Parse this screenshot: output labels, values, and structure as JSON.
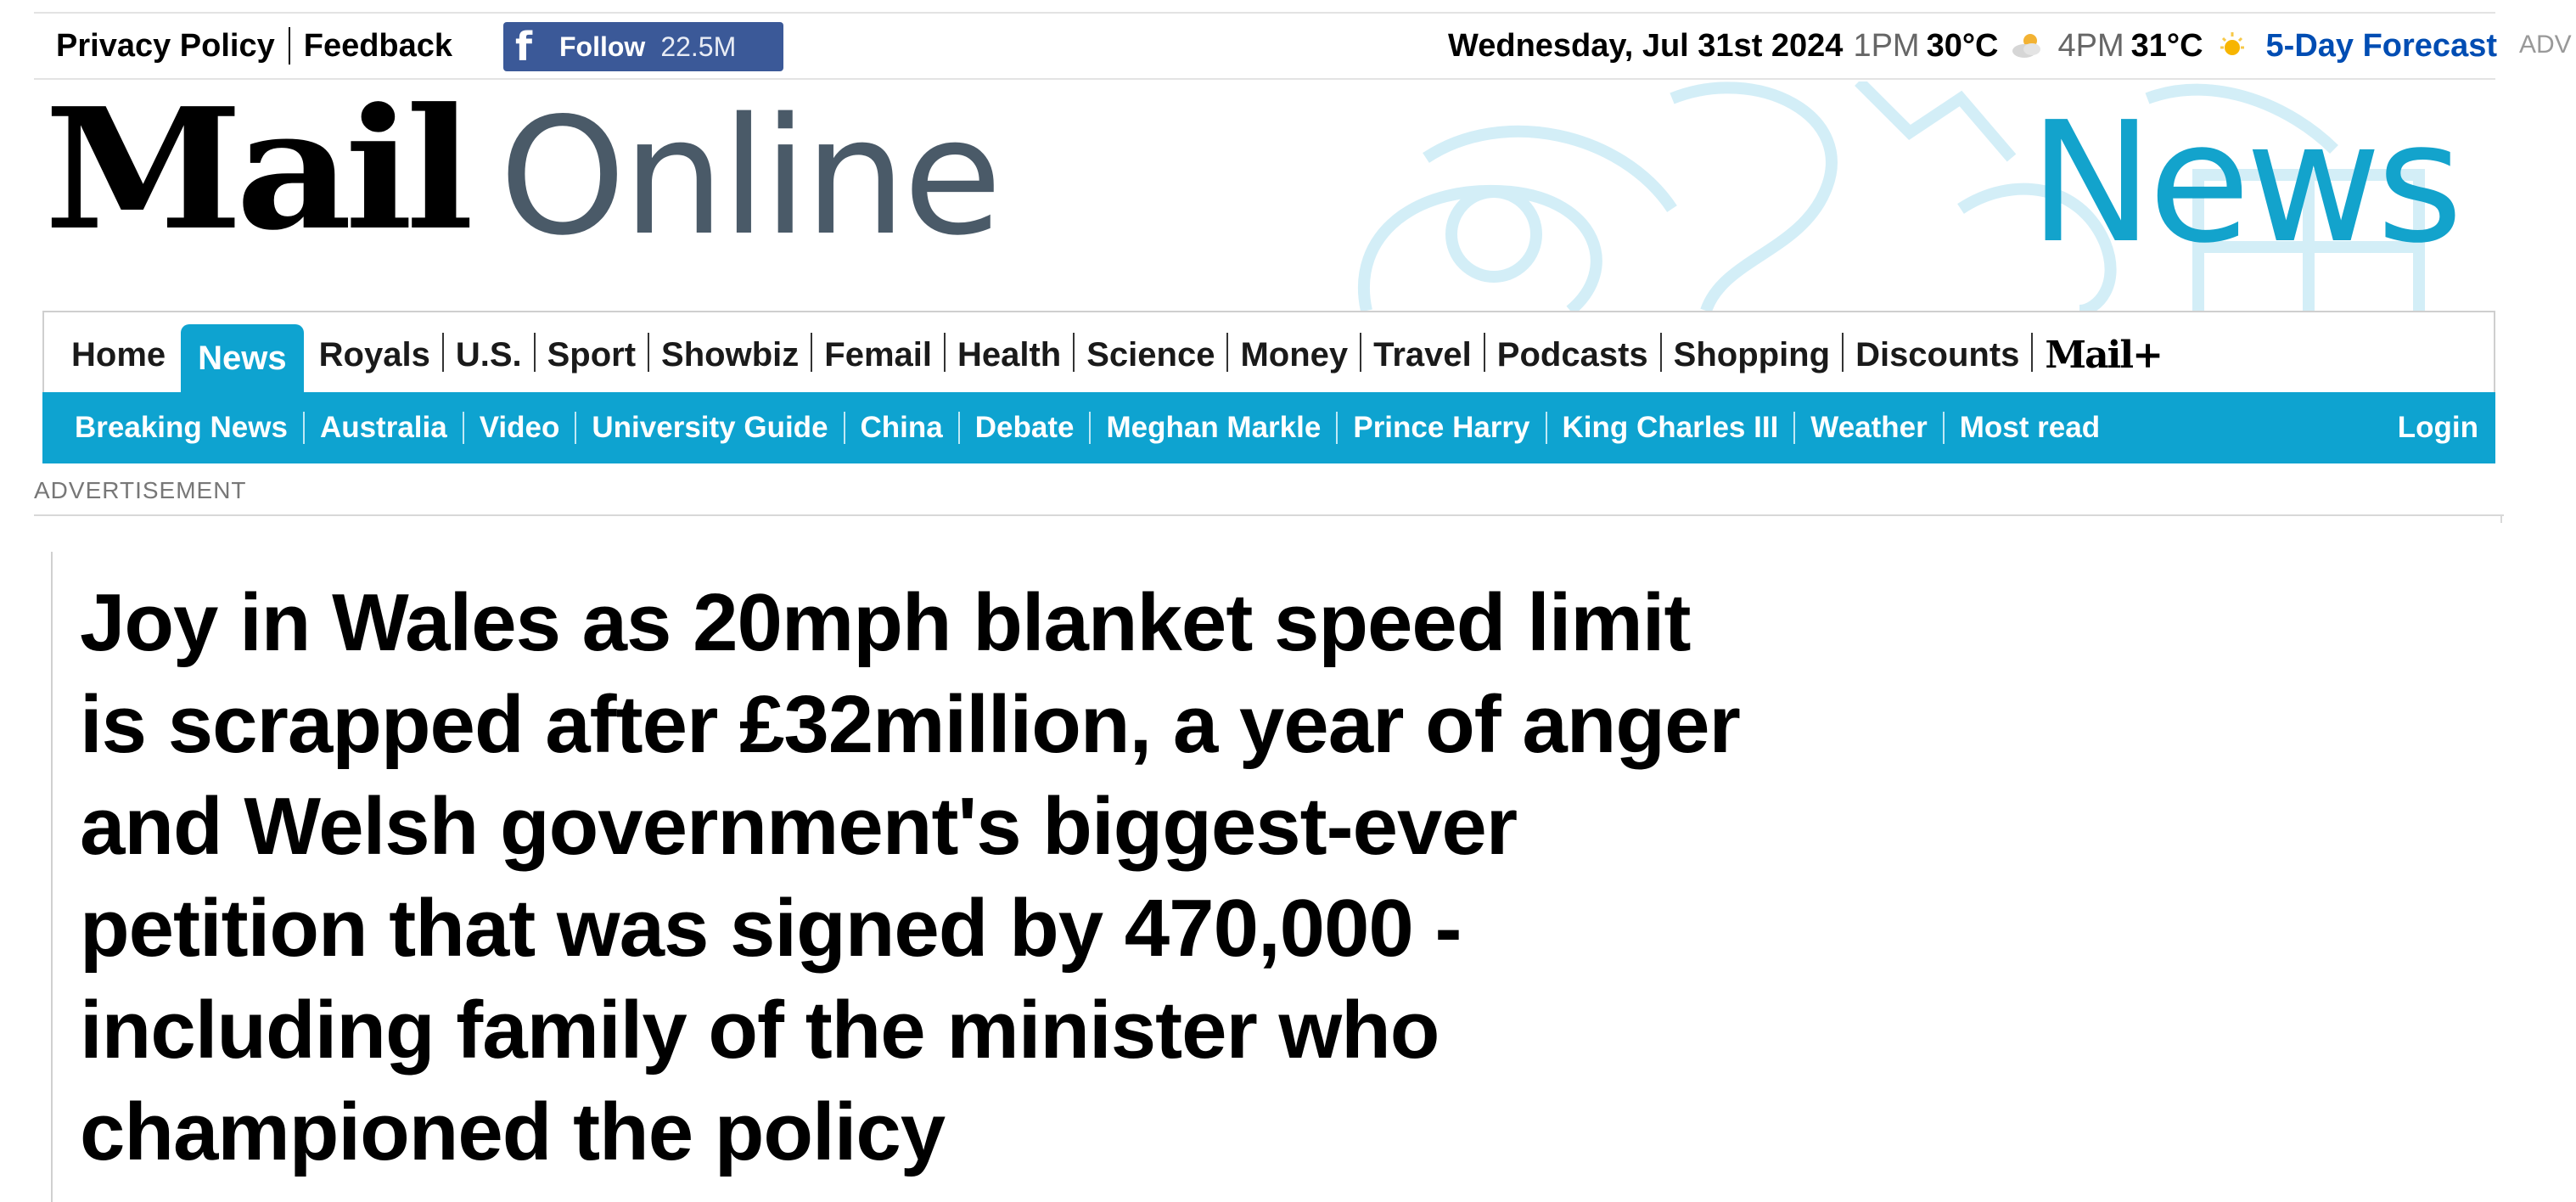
{
  "topbar": {
    "privacy_policy": "Privacy Policy",
    "feedback": "Feedback",
    "facebook": {
      "label": "Follow",
      "count": "22.5M"
    },
    "date": "Wednesday, Jul 31st 2024",
    "weather": [
      {
        "time": "1PM",
        "temp": "30°C",
        "icon": "partly-cloudy-icon"
      },
      {
        "time": "4PM",
        "temp": "31°C",
        "icon": "sun-icon"
      }
    ],
    "forecast_link": "5-Day Forecast",
    "adv_edge": "ADV"
  },
  "masthead": {
    "logo_mail": "Mail",
    "logo_online": "Online",
    "section": "News"
  },
  "nav_primary": {
    "items": [
      "Home",
      "News",
      "Royals",
      "U.S.",
      "Sport",
      "Showbiz",
      "Femail",
      "Health",
      "Science",
      "Money",
      "Travel",
      "Podcasts",
      "Shopping",
      "Discounts"
    ],
    "active": "News",
    "mail_plus": "Mail+"
  },
  "nav_secondary": {
    "items": [
      "Breaking News",
      "Australia",
      "Video",
      "University Guide",
      "China",
      "Debate",
      "Meghan Markle",
      "Prince Harry",
      "King Charles III",
      "Weather",
      "Most read"
    ],
    "login": "Login"
  },
  "advertisement_label": "ADVERTISEMENT",
  "article": {
    "headline": "Joy in Wales as 20mph blanket speed limit is scrapped after £32million, a year of anger and Welsh government's biggest-ever petition that was signed by 470,000 - including family of the minister who championed the policy"
  },
  "colors": {
    "accent": "#0ea3d0",
    "facebook": "#3b5998",
    "forecast_link": "#004db3",
    "news_wordmark": "#13a3cc"
  }
}
